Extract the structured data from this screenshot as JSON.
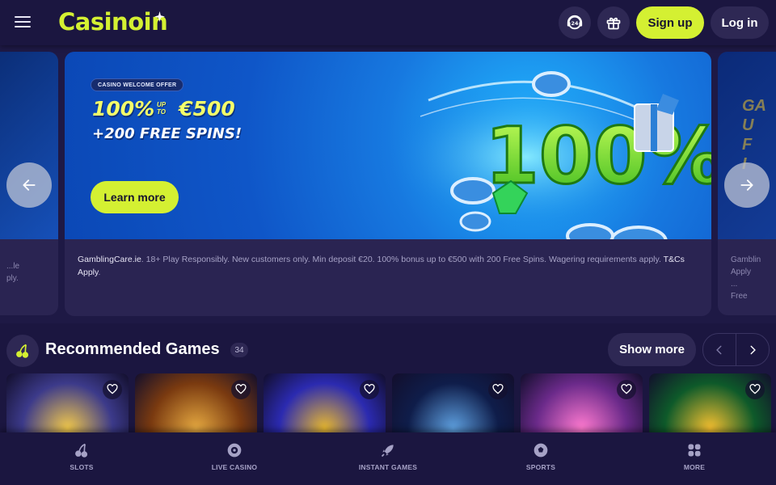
{
  "header": {
    "menu_icon": "hamburger-icon",
    "logo_text": "Casinoin",
    "support_icon": "support-24-icon",
    "gift_icon": "gift-icon",
    "signup_label": "Sign up",
    "login_label": "Log in"
  },
  "hero": {
    "badge": "CASINO WELCOME OFFER",
    "headline_amount": "100%",
    "headline_upto": "UP TO",
    "headline_value": "€500",
    "headline_spins": "+200 FREE SPINS!",
    "graphic_text": "100%",
    "cta_label": "Learn more",
    "disclaimer_site": "GamblingCare.ie",
    "disclaimer_body": ". 18+ Play Responsibly. New customers only. Min deposit €20. 100% bonus up to €500 with 200 Free Spins. Wagering requirements apply. ",
    "disclaimer_tc": "T&Cs",
    "disclaimer_apply": "Apply",
    "slide_count": 3
  },
  "left_peek": {
    "text1": "...le",
    "text2": "ply."
  },
  "right_peek": {
    "text1": "Gamblin",
    "text2": "Apply"
  },
  "recommended": {
    "title": "Recommended Games",
    "count": "34",
    "show_more_label": "Show more",
    "games": [
      {
        "name": "zeus-game",
        "colors": [
          "#3c3a8a",
          "#f2c94c"
        ]
      },
      {
        "name": "book-adventurer-game",
        "colors": [
          "#7a3a10",
          "#e5a840"
        ]
      },
      {
        "name": "joker-game",
        "colors": [
          "#2b2ab0",
          "#e8b830"
        ]
      },
      {
        "name": "jar-game",
        "colors": [
          "#0f1d4a",
          "#5ea0e0"
        ]
      },
      {
        "name": "princess-game",
        "colors": [
          "#6b2a8a",
          "#ff7ad0"
        ]
      },
      {
        "name": "pot-of-gold-game",
        "colors": [
          "#0e5a2a",
          "#f5c030"
        ]
      }
    ]
  },
  "bottom_nav": [
    {
      "label": "SLOTS",
      "icon": "cherry-icon"
    },
    {
      "label": "LIVE CASINO",
      "icon": "roulette-icon"
    },
    {
      "label": "INSTANT GAMES",
      "icon": "rocket-icon"
    },
    {
      "label": "SPORTS",
      "icon": "football-icon"
    },
    {
      "label": "MORE",
      "icon": "grid-icon"
    }
  ],
  "colors": {
    "background": "#1b1640",
    "accent": "#d4f032",
    "card": "#2a2452"
  }
}
